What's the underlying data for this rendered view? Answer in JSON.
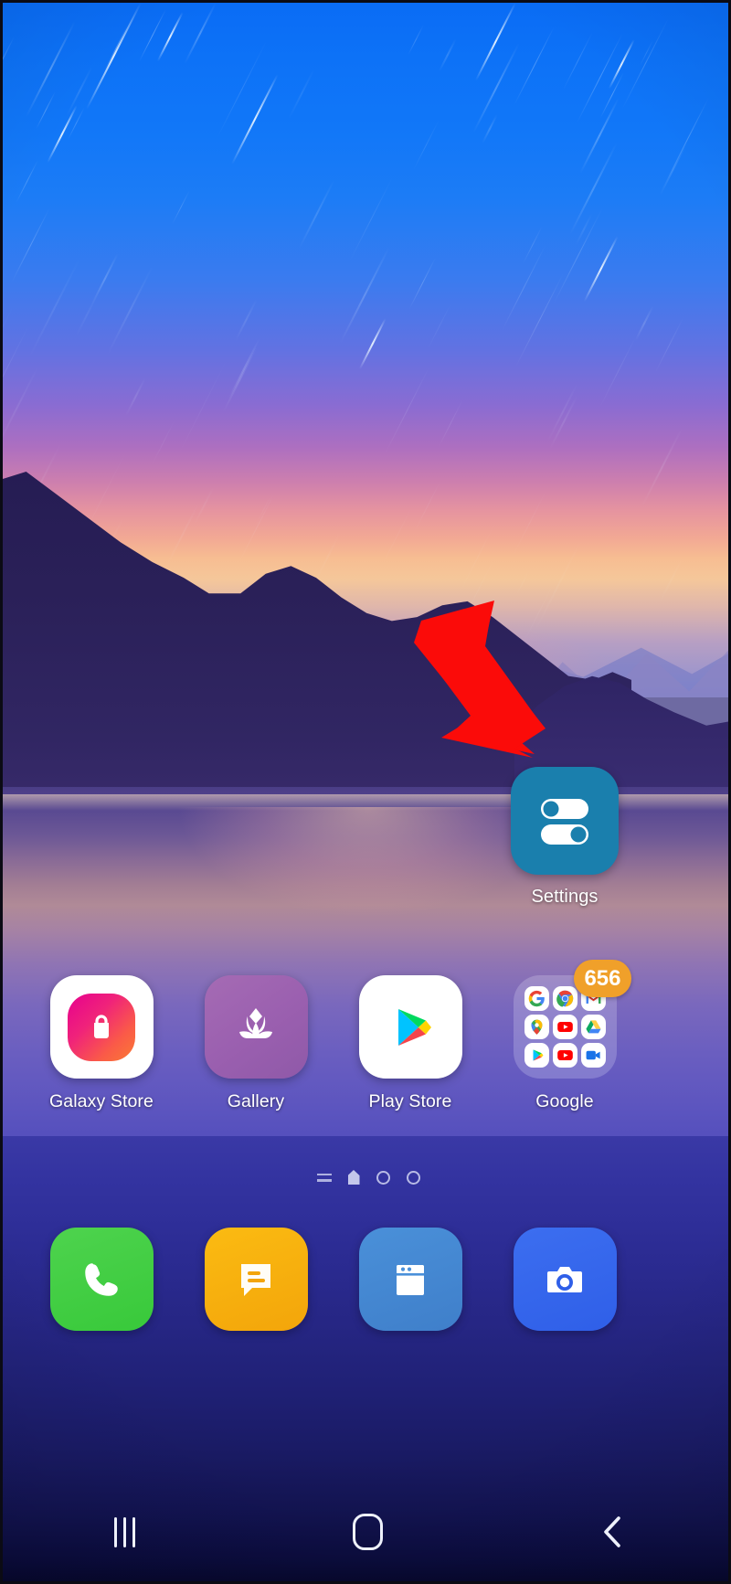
{
  "device": {
    "platform": "Android",
    "skin": "Samsung One UI",
    "screen": "home-screen"
  },
  "wallpaper": {
    "description": "Sunset over mountain lake with star trails",
    "sky_top_color": "#0a6cf5",
    "sunset_glow_color": "#f7bd92",
    "mountain_color": "#241b52",
    "lake_color": "#6a5ec0",
    "ground_color": "#1f2074"
  },
  "annotation": {
    "type": "arrow",
    "color": "#fb0b09",
    "points_to": "Settings",
    "direction": "down-right"
  },
  "highlighted_app": {
    "label": "Settings",
    "icon": "settings-toggles-icon",
    "bg_color": "#1a7fad",
    "toggle_top_state": "off",
    "toggle_bottom_state": "on"
  },
  "app_row": [
    {
      "label": "Galaxy Store",
      "icon": "galaxy-store-icon",
      "bg_color": "#ffffff",
      "accent": "#f0237a"
    },
    {
      "label": "Gallery",
      "icon": "gallery-flower-icon",
      "bg_color": "#9a5faf",
      "accent": "#ffffff"
    },
    {
      "label": "Play Store",
      "icon": "play-store-icon",
      "bg_color": "#ffffff",
      "accent": "#00a0ff"
    },
    {
      "label": "Google",
      "icon": "google-folder-icon",
      "bg_color": "#f0f0ff",
      "badge": "656",
      "badge_color": "#f0a02a"
    }
  ],
  "google_folder_apps": [
    {
      "name": "Google",
      "icon": "google-g-icon"
    },
    {
      "name": "Chrome",
      "icon": "chrome-icon"
    },
    {
      "name": "Gmail",
      "icon": "gmail-icon"
    },
    {
      "name": "Maps",
      "icon": "maps-pin-icon"
    },
    {
      "name": "YouTube",
      "icon": "youtube-icon"
    },
    {
      "name": "Drive",
      "icon": "drive-icon"
    },
    {
      "name": "Play Store",
      "icon": "play-store-icon"
    },
    {
      "name": "YT Music",
      "icon": "yt-music-icon"
    },
    {
      "name": "Meet",
      "icon": "meet-icon"
    }
  ],
  "page_indicator": {
    "pages": [
      "app-list",
      "home",
      "page-3",
      "page-4"
    ],
    "current": "home",
    "count": 4
  },
  "dock": [
    {
      "label": "Phone",
      "icon": "phone-icon",
      "bg_color": "#38c93a"
    },
    {
      "label": "Messages",
      "icon": "message-icon",
      "bg_color": "#f3a50a"
    },
    {
      "label": "Internet",
      "icon": "browser-icon",
      "bg_color": "#4a90d9"
    },
    {
      "label": "Camera",
      "icon": "camera-icon",
      "bg_color": "#2f5fe8"
    }
  ],
  "nav_bar": [
    {
      "label": "Recents",
      "icon": "recents-icon"
    },
    {
      "label": "Home",
      "icon": "home-icon"
    },
    {
      "label": "Back",
      "icon": "back-chevron-icon"
    }
  ]
}
